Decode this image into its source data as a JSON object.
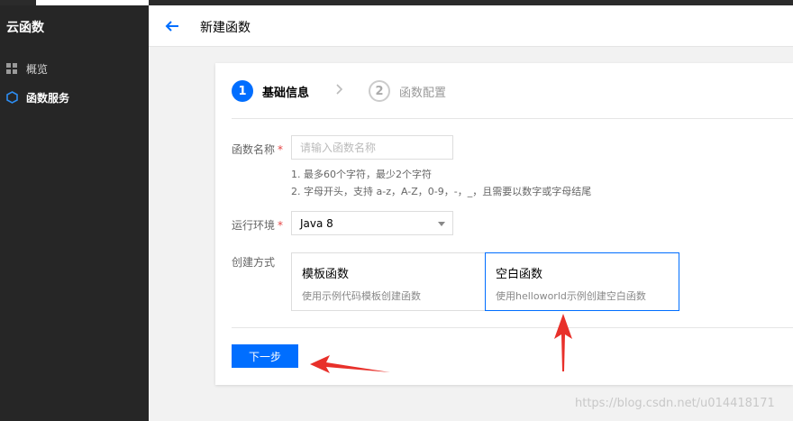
{
  "sidebar": {
    "title": "云函数",
    "items": [
      {
        "label": "概览",
        "icon": "grid-icon"
      },
      {
        "label": "函数服务",
        "icon": "hexagon-icon"
      }
    ]
  },
  "header": {
    "title": "新建函数",
    "back_icon": "arrow-left-icon"
  },
  "steps": [
    {
      "number": "1",
      "label": "基础信息"
    },
    {
      "number": "2",
      "label": "函数配置"
    }
  ],
  "form": {
    "name": {
      "label": "函数名称",
      "placeholder": "请输入函数名称",
      "hints": [
        "1. 最多60个字符，最少2个字符",
        "2. 字母开头，支持 a-z，A-Z，0-9，-，_，且需要以数字或字母结尾"
      ]
    },
    "runtime": {
      "label": "运行环境",
      "value": "Java 8"
    },
    "method": {
      "label": "创建方式",
      "options": [
        {
          "title": "模板函数",
          "desc": "使用示例代码模板创建函数"
        },
        {
          "title": "空白函数",
          "desc": "使用helloworld示例创建空白函数"
        }
      ]
    },
    "required_mark": "*"
  },
  "next_button": "下一步",
  "watermark": "https://blog.csdn.net/u014418171",
  "colors": {
    "accent": "#006eff",
    "sidebar": "#262626",
    "annotation_arrow": "#e8302a"
  }
}
